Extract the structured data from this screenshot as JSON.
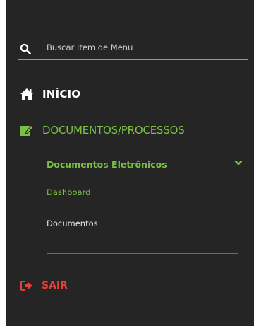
{
  "search": {
    "placeholder": "Buscar Item de Menu"
  },
  "menu": {
    "home": {
      "label": "INÍCIO",
      "icon": "home-icon"
    },
    "documents": {
      "label": "DOCUMENTOS/PROCESSOS",
      "icon": "edit-document-icon"
    },
    "electronic_documents": {
      "label": "Documentos Eletrônicos",
      "icon": "chevron-down-icon"
    },
    "dashboard": {
      "label": "Dashboard"
    },
    "documents_link": {
      "label": "Documentos"
    },
    "logout": {
      "label": "SAIR",
      "icon": "sign-out-icon"
    }
  },
  "colors": {
    "background": "#252526",
    "accent_green": "#7ac143",
    "logout_red": "#e0413b",
    "text_white": "#ffffff"
  }
}
